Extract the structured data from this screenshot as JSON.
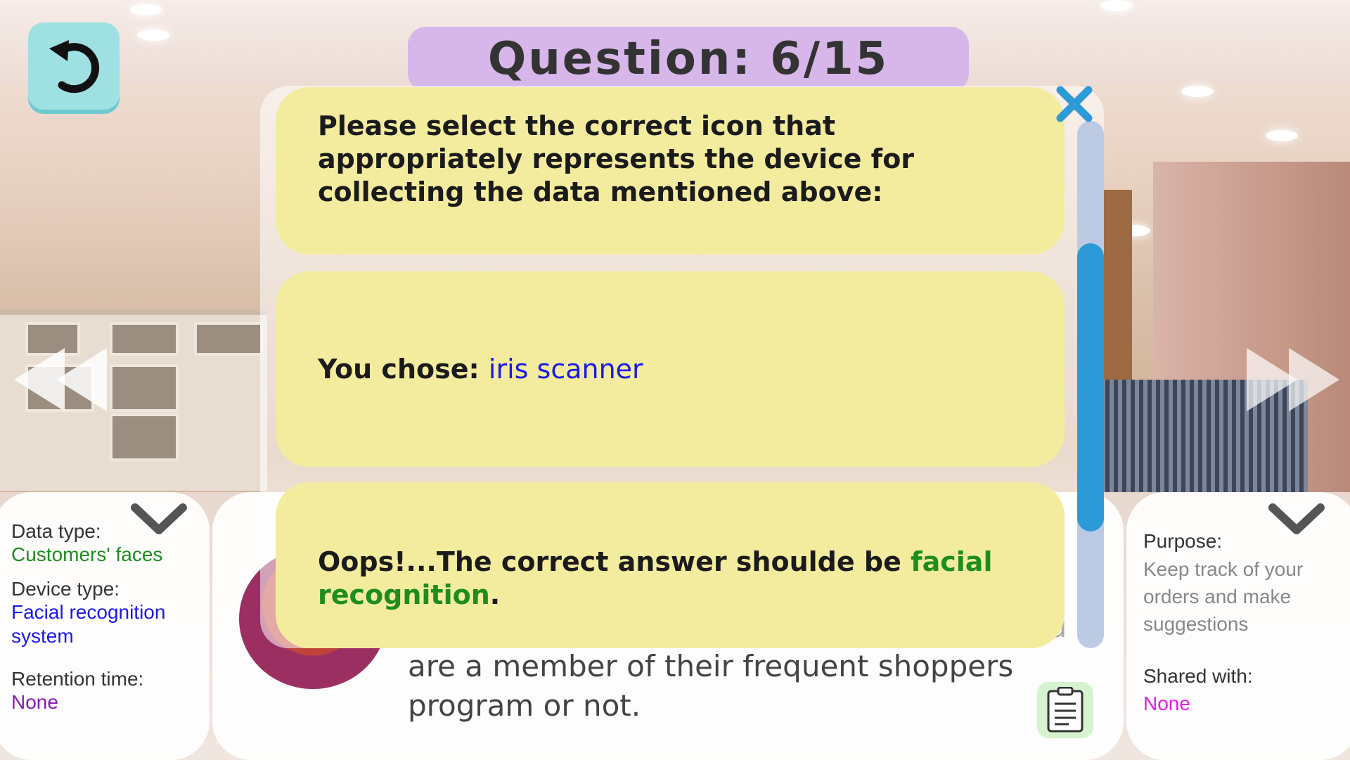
{
  "title": "Question: 6/15",
  "modal": {
    "prompt": "Please select the correct icon that appropriately represents the device for collecting the data mentioned above:",
    "chosen_label": "You chose: ",
    "chosen_value": "iris scanner",
    "feedback_prefix": "Oops!...The correct answer shoulde be ",
    "feedback_answer": "facial recognition",
    "feedback_suffix": ".",
    "close_icon": "close-icon"
  },
  "left_panel": {
    "data_type_label": "Data type:",
    "data_type_value": "Customers' faces",
    "device_type_label": "Device type:",
    "device_type_value": "Facial recognition system",
    "retention_label": "Retention time:",
    "retention_value": "None"
  },
  "story": {
    "text": "This method is to keep track of your orders and make suggestions based on your purchasing habits regardless of whether you are a member of their frequent shoppers program or not."
  },
  "right_panel": {
    "purpose_label": "Purpose:",
    "purpose_value": "Keep track of your orders and make suggestions",
    "shared_label": "Shared with:",
    "shared_value": "None"
  },
  "colors": {
    "green": "#1e8c1e",
    "blue": "#1a1ae6",
    "purple": "#8a1ab3",
    "magenta": "#e020e0",
    "card": "#f3ec9f",
    "scroll_thumb": "#2d9ad8"
  },
  "icons": [
    "undo-icon",
    "rewind-icon",
    "forward-icon",
    "chevron-down-icon",
    "clipboard-icon",
    "close-icon"
  ]
}
